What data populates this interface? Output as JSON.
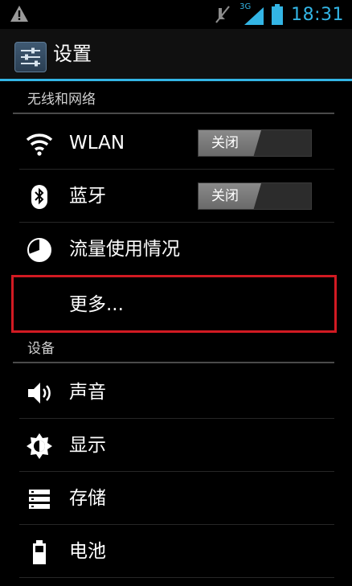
{
  "status_bar": {
    "time": "18:31",
    "network": "3G",
    "icons": [
      "warning-icon",
      "mute-icon",
      "signal-icon",
      "battery-icon"
    ]
  },
  "action_bar": {
    "title": "设置",
    "icon": "settings-icon"
  },
  "sections": {
    "wireless": {
      "header": "无线和网络"
    },
    "device": {
      "header": "设备"
    }
  },
  "items": {
    "wlan": {
      "label": "WLAN",
      "toggle": "关闭",
      "icon": "wifi-icon"
    },
    "bluetooth": {
      "label": "蓝牙",
      "toggle": "关闭",
      "icon": "bluetooth-icon"
    },
    "data_usage": {
      "label": "流量使用情况",
      "icon": "data-usage-icon"
    },
    "more": {
      "label": "更多..."
    },
    "sound": {
      "label": "声音",
      "icon": "sound-icon"
    },
    "display": {
      "label": "显示",
      "icon": "display-icon"
    },
    "storage": {
      "label": "存储",
      "icon": "storage-icon"
    },
    "battery": {
      "label": "电池",
      "icon": "battery-icon"
    }
  },
  "colors": {
    "accent": "#33b5e5",
    "highlight": "#d11a22",
    "background": "#000000"
  }
}
